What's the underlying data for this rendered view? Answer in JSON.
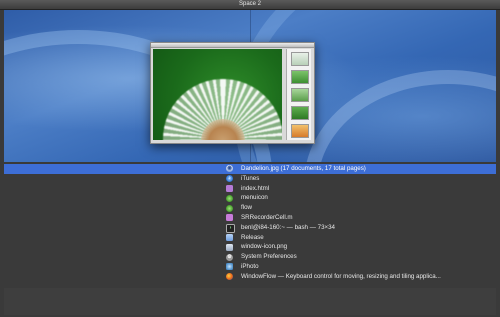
{
  "window_title": "Space 2",
  "colors": {
    "selection": "#3d6ed6",
    "background": "#3a3a3a",
    "text": "#e8e8e8"
  },
  "items": [
    {
      "label": "Dandelion.jpg (17 documents, 17 total pages)",
      "icon": "preview-icon",
      "selected": true
    },
    {
      "label": "iTunes",
      "icon": "itunes-icon",
      "selected": false
    },
    {
      "label": "index.html",
      "icon": "html-file-icon",
      "selected": false
    },
    {
      "label": "menuicon",
      "icon": "app-icon",
      "selected": false
    },
    {
      "label": "flow",
      "icon": "app-icon",
      "selected": false
    },
    {
      "label": "SRRecorderCell.m",
      "icon": "source-file-icon",
      "selected": false
    },
    {
      "label": "benl@i84-160:~ — bash — 73×34",
      "icon": "terminal-icon",
      "selected": false
    },
    {
      "label": "Release",
      "icon": "folder-icon",
      "selected": false
    },
    {
      "label": "window-icon.png",
      "icon": "image-file-icon",
      "selected": false
    },
    {
      "label": "System Preferences",
      "icon": "system-preferences-icon",
      "selected": false
    },
    {
      "label": "iPhoto",
      "icon": "iphoto-icon",
      "selected": false
    },
    {
      "label": "WindowFlow — Keyboard control for moving, resizing and tiling applica...",
      "icon": "firefox-icon",
      "selected": false
    }
  ]
}
